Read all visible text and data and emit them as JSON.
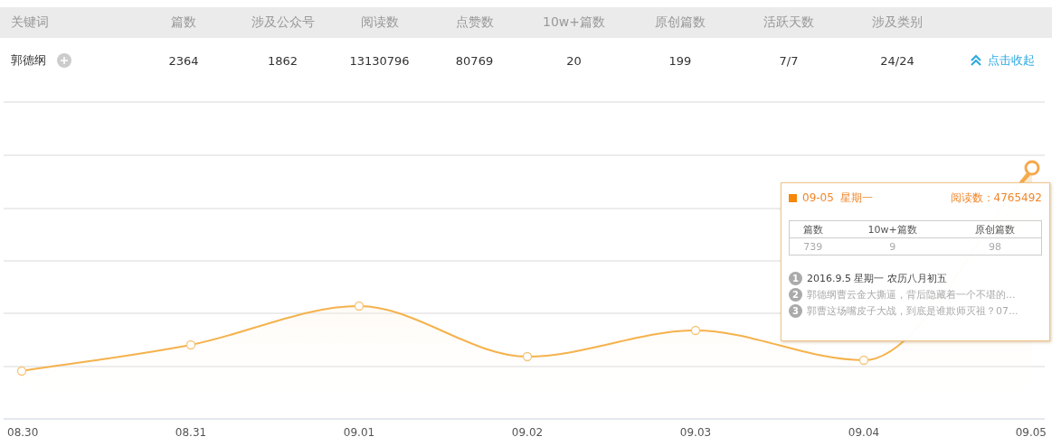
{
  "table": {
    "columns": [
      "关键词",
      "篇数",
      "涉及公众号",
      "阅读数",
      "点赞数",
      "10w+篇数",
      "原创篇数",
      "活跃天数",
      "涉及类别"
    ],
    "row": {
      "keyword": "郭德纲",
      "cells": [
        "2364",
        "1862",
        "13130796",
        "80769",
        "20",
        "199",
        "7/7",
        "24/24"
      ]
    },
    "collapse_link": "点击收起"
  },
  "chart": {
    "x_labels": [
      "08.30",
      "08.31",
      "09.01",
      "09.02",
      "09.03",
      "09.04",
      "09.05"
    ],
    "tooltip": {
      "date": "09-05  星期一",
      "reading": "阅读数：4765492",
      "columns": [
        "篇数",
        "10w+篇数",
        "原创篇数"
      ],
      "values": [
        "739",
        "9",
        "98"
      ],
      "items": [
        {
          "number": "1",
          "text": "2016.9.5 星期一 农历八月初五"
        },
        {
          "number": "2",
          "text": "郭德纲曹云金大撕逼，背后隐藏着一个不堪的..."
        },
        {
          "number": "3",
          "text": "郭曹这场嘴皮子大战，到底是谁欺师灭祖？07..."
        }
      ]
    }
  }
}
